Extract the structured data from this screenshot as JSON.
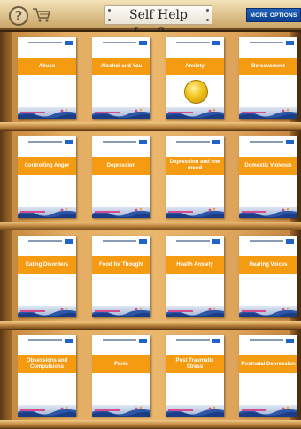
{
  "header": {
    "help_icon_glyph": "?",
    "title": "Self Help Leaflets",
    "more_options_label": "MORE OPTIONS"
  },
  "colors": {
    "band": "#f59b12",
    "more_options_bg": "#0b3f8f",
    "nhs_blue": "#1e63c7"
  },
  "shelves": [
    {
      "leaflets": [
        {
          "title": "Abuse"
        },
        {
          "title": "Alcohol and You"
        },
        {
          "title": "Anxiety"
        },
        {
          "title": "Bereavement"
        }
      ]
    },
    {
      "leaflets": [
        {
          "title": "Controlling Anger"
        },
        {
          "title": "Depression"
        },
        {
          "title": "Depression and low mood"
        },
        {
          "title": "Domestic Violence"
        }
      ]
    },
    {
      "leaflets": [
        {
          "title": "Eating Disorders"
        },
        {
          "title": "Food for Thought"
        },
        {
          "title": "Health Anxiety"
        },
        {
          "title": "Hearing Voices"
        }
      ]
    },
    {
      "leaflets": [
        {
          "title": "Obsessions and Compulsions"
        },
        {
          "title": "Panic"
        },
        {
          "title": "Post Traumatic Stress"
        },
        {
          "title": "Postnatal Depression"
        }
      ]
    }
  ]
}
